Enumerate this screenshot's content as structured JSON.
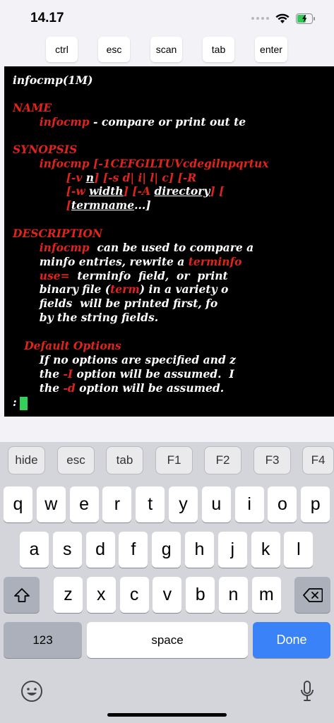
{
  "status_bar": {
    "time": "14.17"
  },
  "accessory_keys": [
    "ctrl",
    "esc",
    "scan",
    "tab",
    "enter"
  ],
  "terminal": {
    "lines": [
      [
        {
          "t": "infocmp(1M)"
        }
      ],
      [],
      [
        {
          "t": "NAME",
          "c": "r"
        }
      ],
      [
        {
          "t": "       "
        },
        {
          "t": "infocmp",
          "c": "r"
        },
        {
          "t": " - compare or print out te"
        }
      ],
      [],
      [
        {
          "t": "SYNOPSIS",
          "c": "r"
        }
      ],
      [
        {
          "t": "       "
        },
        {
          "t": "infocmp [-1CEFGILTUVcdegilnpqrtux",
          "c": "r"
        }
      ],
      [
        {
          "t": "              "
        },
        {
          "t": "[-v ",
          "c": "r"
        },
        {
          "t": "n",
          "u": true
        },
        {
          "t": "] ",
          "c": "r"
        },
        {
          "t": "[-s d| i| l| c]",
          "c": "r"
        },
        {
          "t": " [-R",
          "c": "r"
        }
      ],
      [
        {
          "t": "              "
        },
        {
          "t": "[-w ",
          "c": "r"
        },
        {
          "t": "width",
          "u": true
        },
        {
          "t": "] [-A ",
          "c": "r"
        },
        {
          "t": "directory",
          "u": true
        },
        {
          "t": "] [",
          "c": "r"
        }
      ],
      [
        {
          "t": "              "
        },
        {
          "t": "[",
          "c": "r"
        },
        {
          "t": "termname",
          "u": true
        },
        {
          "t": "...]"
        }
      ],
      [],
      [
        {
          "t": "DESCRIPTION",
          "c": "r"
        }
      ],
      [
        {
          "t": "       "
        },
        {
          "t": "infocmp",
          "c": "r"
        },
        {
          "t": "  can be used to compare a"
        }
      ],
      [
        {
          "t": "       minfo entries, rewrite a "
        },
        {
          "t": "terminfo",
          "c": "r"
        }
      ],
      [
        {
          "t": "       "
        },
        {
          "t": "use=",
          "c": "r"
        },
        {
          "t": "  terminfo  field,  or  print"
        }
      ],
      [
        {
          "t": "       binary file ("
        },
        {
          "t": "term",
          "c": "r"
        },
        {
          "t": ") in a variety o"
        }
      ],
      [
        {
          "t": "       fields  will be printed first, fo"
        }
      ],
      [
        {
          "t": "       by the string fields."
        }
      ],
      [],
      [
        {
          "t": "   "
        },
        {
          "t": "Default Options",
          "c": "r"
        }
      ],
      [
        {
          "t": "       If no options are specified and z"
        }
      ],
      [
        {
          "t": "       the "
        },
        {
          "t": "-I",
          "c": "r"
        },
        {
          "t": " option will be assumed.  I"
        }
      ],
      [
        {
          "t": "       the "
        },
        {
          "t": "-d",
          "c": "r"
        },
        {
          "t": " option will be assumed."
        }
      ],
      [],
      [
        {
          "t": ":"
        }
      ]
    ]
  },
  "function_keys": [
    "hide",
    "esc",
    "tab",
    "F1",
    "F2",
    "F3",
    "F4"
  ],
  "keyboard": {
    "row1": [
      "q",
      "w",
      "e",
      "r",
      "t",
      "y",
      "u",
      "i",
      "o",
      "p"
    ],
    "row2": [
      "a",
      "s",
      "d",
      "f",
      "g",
      "h",
      "j",
      "k",
      "l"
    ],
    "row3": [
      "z",
      "x",
      "c",
      "v",
      "b",
      "n",
      "m"
    ],
    "numbers_label": "123",
    "space_label": "space",
    "done_label": "Done"
  },
  "icons": {
    "wifi": "wifi-icon",
    "battery": "battery-charging-icon",
    "shift": "shift-icon",
    "backspace": "backspace-icon",
    "emoji": "emoji-icon",
    "mic": "microphone-icon"
  },
  "colors": {
    "terminal_bg": "#000000",
    "terminal_text": "#ffffff",
    "terminal_highlight": "#e0241b",
    "cursor": "#34d05a",
    "done_button": "#3a82f7"
  }
}
